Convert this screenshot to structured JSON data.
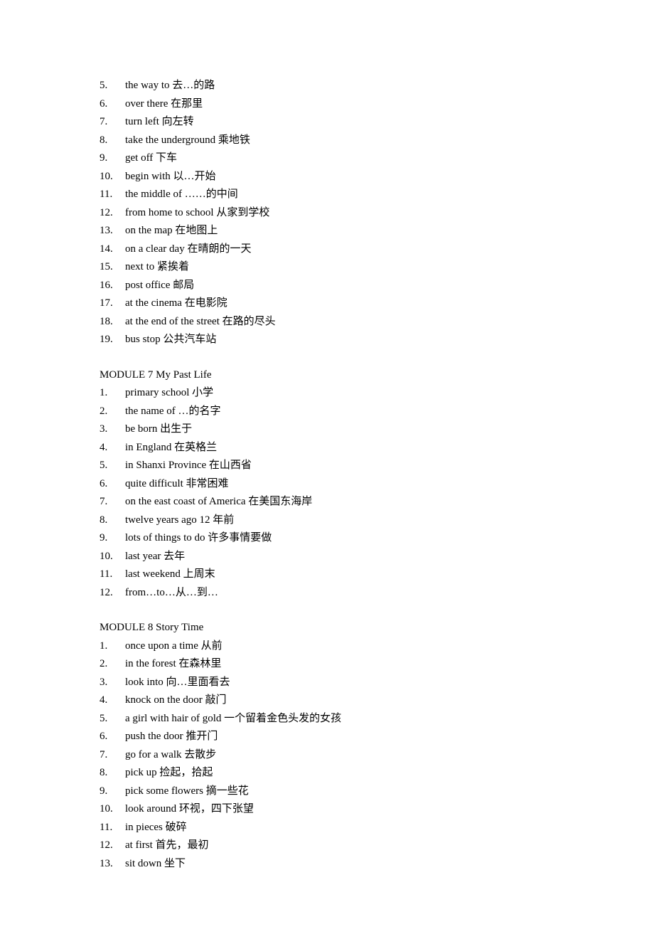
{
  "sections": [
    {
      "title": null,
      "start": 5,
      "items": [
        "the way to 去…的路",
        "over there 在那里",
        "turn left 向左转",
        "take the underground 乘地铁",
        "get off 下车",
        "begin with 以…开始",
        "the middle of ……的中间",
        "from home to school 从家到学校",
        "on the map 在地图上",
        "on a clear day 在晴朗的一天",
        "next to 紧挨着",
        "post office 邮局",
        "at the cinema 在电影院",
        "at the end of the street 在路的尽头",
        "bus stop 公共汽车站"
      ]
    },
    {
      "title": "MODULE 7 My Past Life",
      "start": 1,
      "items": [
        "primary school 小学",
        "the name of …的名字",
        "be born 出生于",
        "in England 在英格兰",
        "in Shanxi Province 在山西省",
        "quite difficult 非常困难",
        "on the east coast of America 在美国东海岸",
        "twelve years ago 12 年前",
        "lots of things to do 许多事情要做",
        "last year 去年",
        "last weekend 上周末",
        "from…to…从…到…"
      ]
    },
    {
      "title": "MODULE 8 Story Time",
      "start": 1,
      "items": [
        "once upon a time 从前",
        "in the forest 在森林里",
        "look into 向…里面看去",
        "knock on the door 敲门",
        "a girl with hair of gold 一个留着金色头发的女孩",
        "push the door 推开门",
        "go for a walk 去散步",
        "pick up 捡起，拾起",
        "pick some flowers 摘一些花",
        "look around 环视，四下张望",
        "in pieces 破碎",
        "at first 首先，最初",
        "sit down 坐下"
      ]
    }
  ]
}
